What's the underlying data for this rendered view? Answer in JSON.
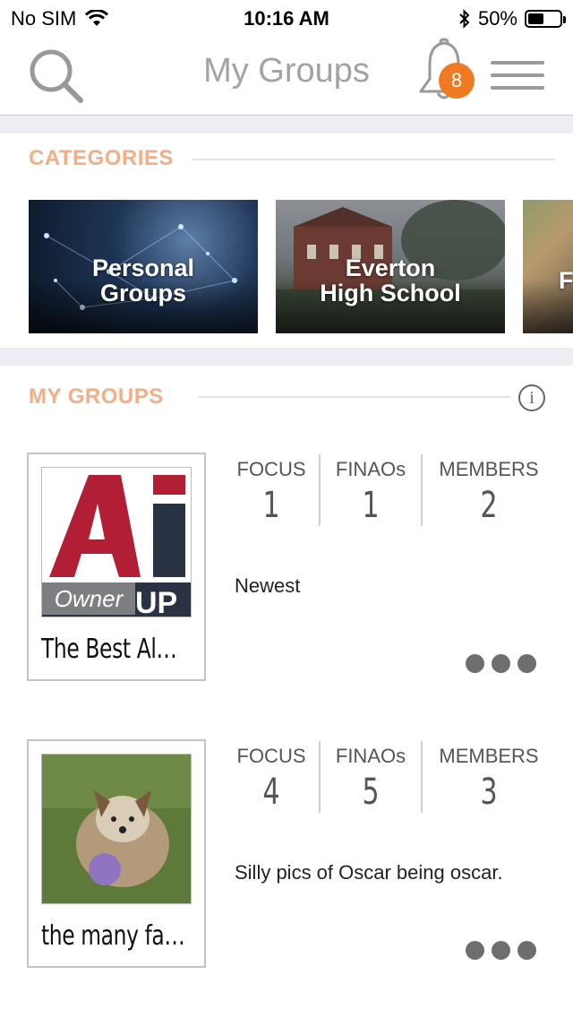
{
  "status_bar": {
    "carrier": "No SIM",
    "time": "10:16 AM",
    "battery_percent": "50%",
    "battery_level": 0.5
  },
  "navbar": {
    "title": "My Groups",
    "notification_count": "8"
  },
  "categories": {
    "heading": "CATEGORIES",
    "cards": [
      {
        "line1": "Personal",
        "line2": "Groups"
      },
      {
        "line1": "Everton",
        "line2": "High School"
      },
      {
        "line1": "F",
        "line2": ""
      }
    ]
  },
  "my_groups": {
    "heading": "MY GROUPS",
    "groups": [
      {
        "name": "The Best Al…",
        "role_badge": "Owner",
        "logo_text": "Ai",
        "logo_subtext": "UP",
        "focus_label": "FOCUS",
        "focus_value": "1",
        "finaos_label": "FINAOs",
        "finaos_value": "1",
        "members_label": "MEMBERS",
        "members_value": "2",
        "description": "Newest"
      },
      {
        "name": "the many fa…",
        "focus_label": "FOCUS",
        "focus_value": "4",
        "finaos_label": "FINAOs",
        "finaos_value": "5",
        "members_label": "MEMBERS",
        "members_value": "3",
        "description": "Silly pics of Oscar being oscar."
      }
    ]
  },
  "colors": {
    "accent": "#f5ad85",
    "badge": "#f07a21"
  }
}
